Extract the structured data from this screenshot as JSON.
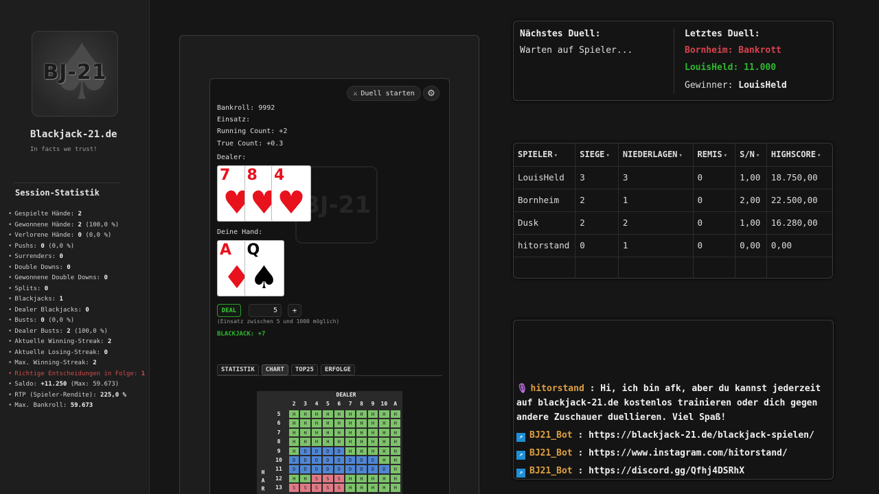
{
  "sidebar": {
    "logo_text": "BJ-21",
    "site_title": "Blackjack-21.de",
    "tagline": "In facts we trust!",
    "stats_title": "Session-Statistik",
    "stats": [
      {
        "label": "Gespielte Hände: ",
        "value": "2"
      },
      {
        "label": "Gewonnene Hände: ",
        "value": "2",
        "extra": " (100,0 %)"
      },
      {
        "label": "Verlorene Hände: ",
        "value": "0",
        "extra": " (0,0 %)"
      },
      {
        "label": "Pushs: ",
        "value": "0",
        "extra": " (0,0 %)"
      },
      {
        "label": "Surrenders: ",
        "value": "0"
      },
      {
        "label": "Double Downs: ",
        "value": "0"
      },
      {
        "label": "Gewonnene Double Downs: ",
        "value": "0"
      },
      {
        "label": "Splits: ",
        "value": "0"
      },
      {
        "label": "Blackjacks: ",
        "value": "1"
      },
      {
        "label": "Dealer Blackjacks: ",
        "value": "0"
      },
      {
        "label": "Busts: ",
        "value": "0",
        "extra": " (0,0 %)"
      },
      {
        "label": "Dealer Busts: ",
        "value": "2",
        "extra": " (100,0 %)"
      },
      {
        "label": "Aktuelle Winning-Streak: ",
        "value": "2"
      },
      {
        "label": "Aktuelle Losing-Streak: ",
        "value": "0"
      },
      {
        "label": "Max. Winning-Streak: ",
        "value": "2"
      },
      {
        "label": "Richtige Entscheidungen in Folge: ",
        "value": "1",
        "red": true
      },
      {
        "label": "Saldo: ",
        "value": "+11.250",
        "extra": " (Max: 59.673)"
      },
      {
        "label": "RTP (Spieler-Rendite): ",
        "value": "225,0 %"
      },
      {
        "label": "Max. Bankroll: ",
        "value": "59.673"
      }
    ]
  },
  "game": {
    "duel_button": "Duell starten",
    "duel_icon": "⚔",
    "bankroll": "Bankroll: 9992",
    "einsatz": "Einsatz:",
    "running_count": "Running Count: +2",
    "true_count": "True Count: +0.3",
    "dealer_label": "Dealer:",
    "dealer_cards": [
      {
        "rank": "7",
        "suit": "♥",
        "color": "red"
      },
      {
        "rank": "8",
        "suit": "♥",
        "color": "red"
      },
      {
        "rank": "4",
        "suit": "♥",
        "color": "red"
      }
    ],
    "hand_label": "Deine Hand:",
    "hand_cards": [
      {
        "rank": "A",
        "suit": "♦",
        "color": "red"
      },
      {
        "rank": "Q",
        "suit": "♠",
        "color": "black"
      }
    ],
    "deal_label": "DEAL",
    "bet_value": "5",
    "plus_label": "+",
    "bet_hint": "(Einsatz zwischen 5 und 1000 möglich)",
    "result": "BLACKJACK: +7",
    "tabs": [
      "STATISTIK",
      "CHART",
      "TOP25",
      "ERFOLGE"
    ],
    "active_tab": "CHART"
  },
  "strategy_chart": {
    "title": "DEALER",
    "dealer_cards": [
      "2",
      "3",
      "4",
      "5",
      "6",
      "7",
      "8",
      "9",
      "10",
      "A"
    ],
    "side_label": "HARD",
    "rows": [
      {
        "total": "5",
        "actions": [
          "H",
          "H",
          "H",
          "H",
          "H",
          "H",
          "H",
          "H",
          "H",
          "H"
        ]
      },
      {
        "total": "6",
        "actions": [
          "H",
          "H",
          "H",
          "H",
          "H",
          "H",
          "H",
          "H",
          "H",
          "H"
        ]
      },
      {
        "total": "7",
        "actions": [
          "H",
          "H",
          "H",
          "H",
          "H",
          "H",
          "H",
          "H",
          "H",
          "H"
        ]
      },
      {
        "total": "8",
        "actions": [
          "H",
          "H",
          "H",
          "H",
          "H",
          "H",
          "H",
          "H",
          "H",
          "H"
        ]
      },
      {
        "total": "9",
        "actions": [
          "H",
          "D",
          "D",
          "D",
          "D",
          "H",
          "H",
          "H",
          "H",
          "H"
        ]
      },
      {
        "total": "10",
        "actions": [
          "D",
          "D",
          "D",
          "D",
          "D",
          "D",
          "D",
          "D",
          "H",
          "H"
        ]
      },
      {
        "total": "11",
        "actions": [
          "D",
          "D",
          "D",
          "D",
          "D",
          "D",
          "D",
          "D",
          "D",
          "H"
        ]
      },
      {
        "total": "12",
        "actions": [
          "H",
          "H",
          "S",
          "S",
          "S",
          "H",
          "H",
          "H",
          "H",
          "H"
        ]
      },
      {
        "total": "13",
        "actions": [
          "S",
          "S",
          "S",
          "S",
          "S",
          "H",
          "H",
          "H",
          "H",
          "H"
        ]
      }
    ]
  },
  "duel": {
    "next_title": "Nächstes Duell:",
    "next_status": "Warten auf Spieler...",
    "last_title": "Letztes Duell:",
    "last_line1": "Bornheim: Bankrott",
    "last_line2": "LouisHeld: 11.000",
    "winner_label": "Gewinner: ",
    "winner_name": "LouisHeld",
    "colors": {
      "loser": "#d8434f",
      "winner": "#2fb82f"
    }
  },
  "leaderboard": {
    "columns": [
      "SPIELER",
      "SIEGE",
      "NIEDERLAGEN",
      "REMIS",
      "S/N",
      "HIGHSCORE"
    ],
    "rows": [
      [
        "LouisHeld",
        "3",
        "3",
        "0",
        "1,00",
        "18.750,00"
      ],
      [
        "Bornheim",
        "2",
        "1",
        "0",
        "2,00",
        "22.500,00"
      ],
      [
        "Dusk",
        "2",
        "2",
        "0",
        "1,00",
        "16.280,00"
      ],
      [
        "hitorstand",
        "0",
        "1",
        "0",
        "0,00",
        "0,00"
      ]
    ]
  },
  "chat": {
    "messages": [
      {
        "user": "hitorstand",
        "badge": "mic",
        "text": "Hi, ich bin afk, aber du kannst jederzeit auf blackjack-21.de kostenlos trainieren oder dich gegen andere Zuschauer duellieren. Viel Spaß!"
      },
      {
        "user": "BJ21_Bot",
        "badge": "bot",
        "text": "https://blackjack-21.de/blackjack-spielen/"
      },
      {
        "user": "BJ21_Bot",
        "badge": "bot",
        "text": "https://www.instagram.com/hitorstand/"
      },
      {
        "user": "BJ21_Bot",
        "badge": "bot",
        "text": "https://discord.gg/Qfhj4DSRhX"
      }
    ]
  }
}
